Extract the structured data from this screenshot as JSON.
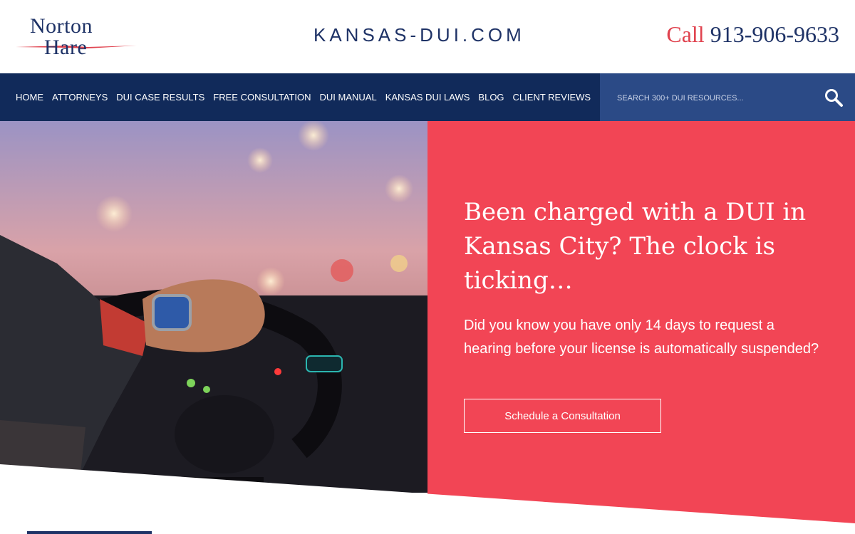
{
  "header": {
    "logo": {
      "line1": "Norton",
      "line2": "Hare"
    },
    "site_name": "KANSAS-DUI.COM",
    "phone": {
      "label": "Call",
      "number": "913-906-9633"
    }
  },
  "nav": {
    "items": [
      {
        "label": "HOME"
      },
      {
        "label": "ATTORNEYS"
      },
      {
        "label": "DUI CASE RESULTS"
      },
      {
        "label": "FREE CONSULTATION"
      },
      {
        "label": "DUI MANUAL"
      },
      {
        "label": "KANSAS DUI LAWS"
      },
      {
        "label": "BLOG"
      },
      {
        "label": "CLIENT REVIEWS"
      }
    ]
  },
  "search": {
    "placeholder": "SEARCH 300+ DUI RESOURCES...",
    "icon": "search-icon"
  },
  "hero": {
    "headline": "Been charged with a DUI in Kansas City? The clock is ticking…",
    "subtext": "Did you know you have only 14 days to request a hearing before your license is automatically suspended?",
    "cta_label": "Schedule a Consultation"
  },
  "colors": {
    "navy": "#112a5a",
    "search_bg": "#2b4a86",
    "accent_red": "#f24555",
    "brand_blue": "#1e3266"
  }
}
